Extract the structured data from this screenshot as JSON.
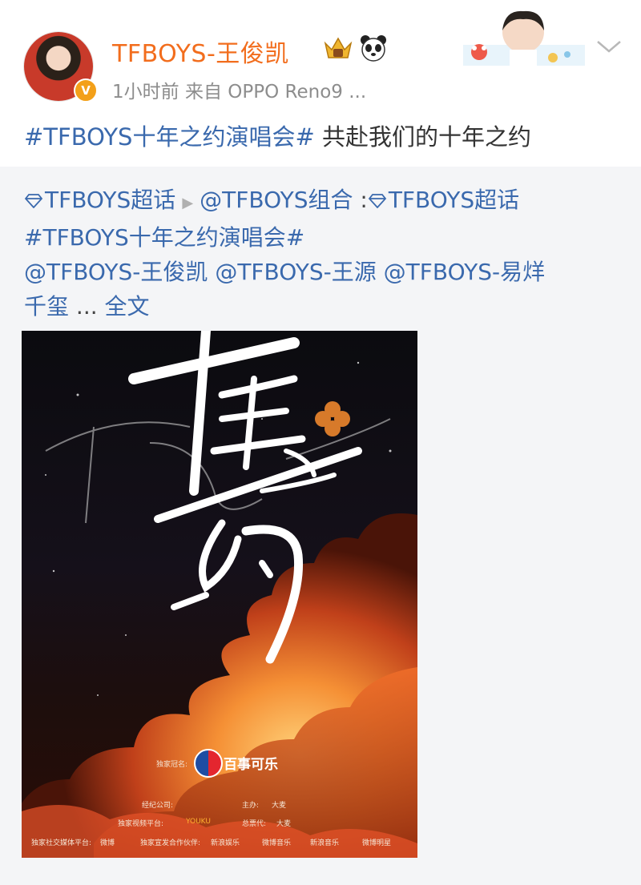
{
  "post": {
    "username": "TFBOYS-王俊凯",
    "verified_mark": "V",
    "meta": "1小时前  来自 OPPO Reno9 ...",
    "badges": [
      "crown-badge-icon",
      "panda-icon"
    ],
    "text_hashtag": "#TFBOYS十年之约演唱会#",
    "text_body": " 共赴我们的十年之约"
  },
  "repost": {
    "supertopic": "TFBOYS超话",
    "source": "@TFBOYS组合",
    "colon": " :",
    "supertopic2": "TFBOYS超话",
    "hashtag": "#TFBOYS十年之约演唱会#",
    "mention1": "@TFBOYS-王俊凯",
    "mention2": "@TFBOYS-王源",
    "mention3": "@TFBOYS-易烊",
    "mention3_cont": "千玺",
    "ellipsis": " ... ",
    "full_text_link": "全文"
  },
  "poster": {
    "title_calligraphy": "十年之约",
    "sponsor_prefix": "独家冠名:",
    "sponsor": "百事可乐",
    "credits": {
      "agency_label": "经纪公司:",
      "host_label": "主办:",
      "host": "大麦",
      "video_label": "独家视频平台:",
      "video": "YOUKU",
      "ticket_label": "总票代:",
      "ticket": "大麦",
      "social_label": "独家社交媒体平台:",
      "social": "微博",
      "partner_label": "独家宣发合作伙伴:",
      "partner1": "新浪娱乐",
      "partner2": "微博音乐",
      "partner3": "新浪音乐",
      "partner4": "微博明星"
    }
  },
  "colors": {
    "username": "#f26d1d",
    "link": "#3a69ad",
    "meta": "#8d8d8d",
    "repost_bg": "#f4f5f7"
  }
}
